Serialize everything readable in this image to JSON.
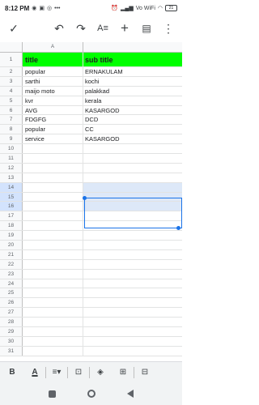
{
  "status": {
    "time": "8:12 PM",
    "left_icons": [
      "whatsapp-icon",
      "notification-icon",
      "instagram-icon",
      "more-dots-icon"
    ],
    "right_icons": [
      "alarm-icon",
      "wifi-icon",
      "signal-icon"
    ],
    "network_label": "Vo WiFi",
    "battery": "21"
  },
  "toolbar": {
    "icons": [
      "check-icon",
      "undo-icon",
      "redo-icon",
      "text-format-icon",
      "add-icon",
      "comment-icon",
      "more-vert-icon"
    ]
  },
  "sheet": {
    "column_headers": [
      "A",
      ""
    ],
    "rows": [
      {
        "n": "1",
        "a": "title",
        "b": "sub title"
      },
      {
        "n": "2",
        "a": "popular",
        "b": "ERNAKULAM"
      },
      {
        "n": "3",
        "a": "sarthi",
        "b": "kochi"
      },
      {
        "n": "4",
        "a": "maijo moto",
        "b": "palakkad"
      },
      {
        "n": "5",
        "a": "kvr",
        "b": "kerala"
      },
      {
        "n": "6",
        "a": "AVG",
        "b": "KASARGOD"
      },
      {
        "n": "7",
        "a": "FDGFG",
        "b": "DCD"
      },
      {
        "n": "8",
        "a": "popular",
        "b": "CC"
      },
      {
        "n": "9",
        "a": "service",
        "b": "KASARGOD"
      },
      {
        "n": "10",
        "a": "",
        "b": ""
      },
      {
        "n": "11",
        "a": "",
        "b": ""
      },
      {
        "n": "12",
        "a": "",
        "b": ""
      },
      {
        "n": "13",
        "a": "",
        "b": ""
      },
      {
        "n": "14",
        "a": "",
        "b": ""
      },
      {
        "n": "15",
        "a": "",
        "b": ""
      },
      {
        "n": "16",
        "a": "",
        "b": ""
      },
      {
        "n": "17",
        "a": "",
        "b": ""
      },
      {
        "n": "18",
        "a": "",
        "b": ""
      },
      {
        "n": "19",
        "a": "",
        "b": ""
      },
      {
        "n": "20",
        "a": "",
        "b": ""
      },
      {
        "n": "21",
        "a": "",
        "b": ""
      },
      {
        "n": "22",
        "a": "",
        "b": ""
      },
      {
        "n": "23",
        "a": "",
        "b": ""
      },
      {
        "n": "24",
        "a": "",
        "b": ""
      },
      {
        "n": "25",
        "a": "",
        "b": ""
      },
      {
        "n": "26",
        "a": "",
        "b": ""
      },
      {
        "n": "27",
        "a": "",
        "b": ""
      },
      {
        "n": "28",
        "a": "",
        "b": ""
      },
      {
        "n": "29",
        "a": "",
        "b": ""
      },
      {
        "n": "30",
        "a": "",
        "b": ""
      },
      {
        "n": "31",
        "a": "",
        "b": ""
      }
    ],
    "header_fill": "#00ff00",
    "selection_color": "#1a73e8"
  },
  "format_bar": {
    "bold_label": "B",
    "text_color_label": "A",
    "icons": [
      "bold-icon",
      "text-color-icon",
      "align-icon",
      "merge-cells-icon",
      "fill-color-icon",
      "borders-icon",
      "insert-icon"
    ]
  },
  "nav": {
    "icons": [
      "recents-icon",
      "home-icon",
      "back-icon"
    ]
  }
}
